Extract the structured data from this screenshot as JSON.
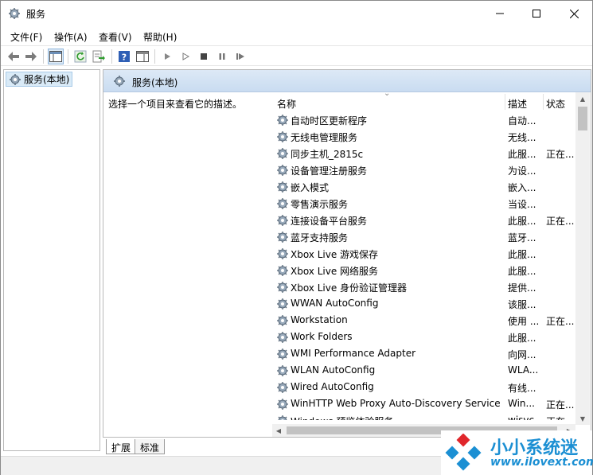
{
  "window": {
    "title": "服务"
  },
  "menu": {
    "items": [
      "文件(F)",
      "操作(A)",
      "查看(V)",
      "帮助(H)"
    ]
  },
  "tree": {
    "root_label": "服务(本地)"
  },
  "main": {
    "header_label": "服务(本地)",
    "description_hint": "选择一个项目来查看它的描述。",
    "columns": {
      "name": "名称",
      "desc": "描述",
      "status": "状态"
    },
    "rows": [
      {
        "name": "自动时区更新程序",
        "desc": "自动...",
        "status": ""
      },
      {
        "name": "无线电管理服务",
        "desc": "无线...",
        "status": ""
      },
      {
        "name": "同步主机_2815c",
        "desc": "此服...",
        "status": "正在..."
      },
      {
        "name": "设备管理注册服务",
        "desc": "为设...",
        "status": ""
      },
      {
        "name": "嵌入模式",
        "desc": "嵌入...",
        "status": ""
      },
      {
        "name": "零售演示服务",
        "desc": "当设...",
        "status": ""
      },
      {
        "name": "连接设备平台服务",
        "desc": "此服...",
        "status": "正在..."
      },
      {
        "name": "蓝牙支持服务",
        "desc": "蓝牙...",
        "status": ""
      },
      {
        "name": "Xbox Live 游戏保存",
        "desc": "此服...",
        "status": ""
      },
      {
        "name": "Xbox Live 网络服务",
        "desc": "此服...",
        "status": ""
      },
      {
        "name": "Xbox Live 身份验证管理器",
        "desc": "提供...",
        "status": ""
      },
      {
        "name": "WWAN AutoConfig",
        "desc": "该服...",
        "status": ""
      },
      {
        "name": "Workstation",
        "desc": "使用 ...",
        "status": "正在..."
      },
      {
        "name": "Work Folders",
        "desc": "此服...",
        "status": ""
      },
      {
        "name": "WMI Performance Adapter",
        "desc": "向网...",
        "status": ""
      },
      {
        "name": "WLAN AutoConfig",
        "desc": "WLA...",
        "status": ""
      },
      {
        "name": "Wired AutoConfig",
        "desc": "有线...",
        "status": ""
      },
      {
        "name": "WinHTTP Web Proxy Auto-Discovery Service",
        "desc": "Win...",
        "status": "正在..."
      },
      {
        "name": "Windows 预览体验服务",
        "desc": "wisvc",
        "status": "正在..."
      }
    ]
  },
  "tabs": {
    "extended": "扩展",
    "standard": "标准"
  },
  "watermark": {
    "text": "小小系统迷",
    "url": "www.ilovext.com"
  },
  "colors": {
    "accent": "#1b8fd3",
    "header_gradient": "#c9dcf1",
    "selection": "#d9eaf7"
  }
}
